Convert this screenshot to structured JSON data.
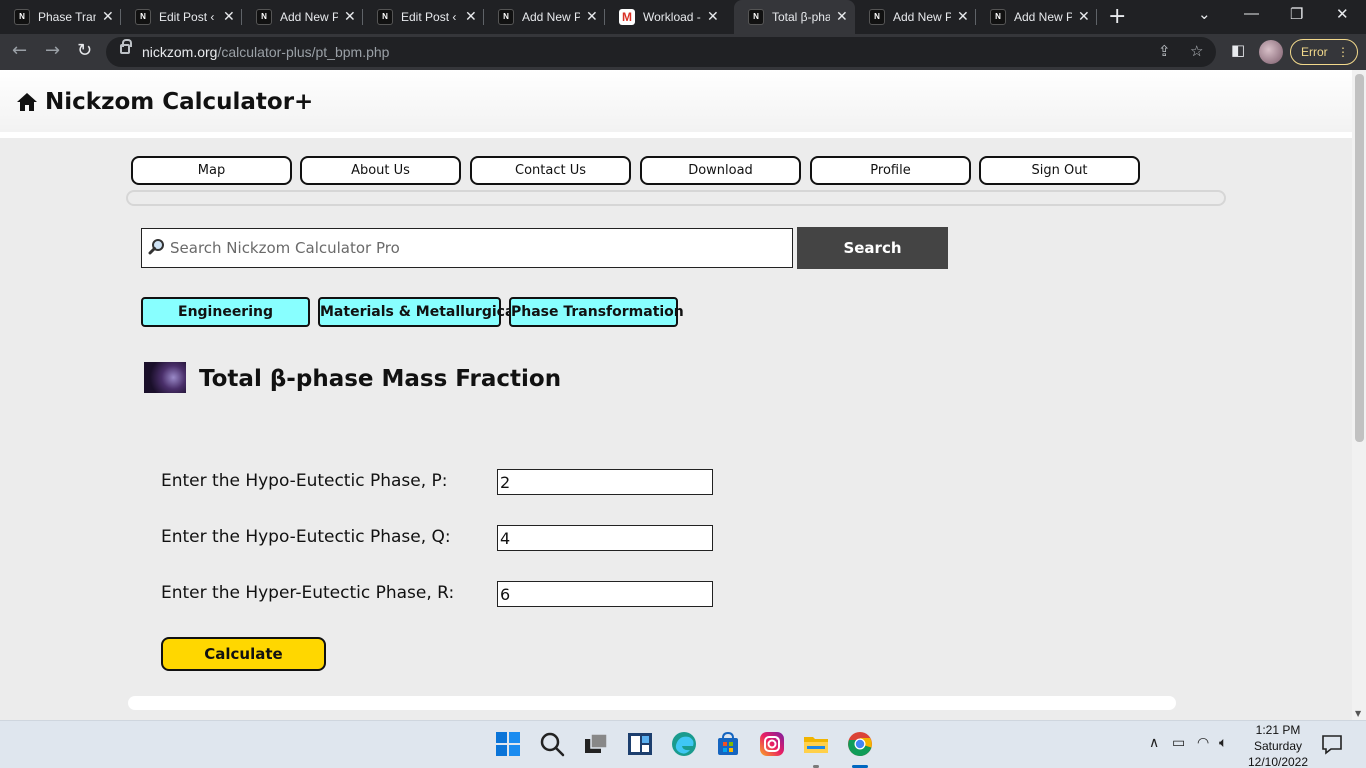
{
  "browser": {
    "tabs": [
      {
        "title": "Phase Tran",
        "icon": "nickzom-icon"
      },
      {
        "title": "Edit Post ‹",
        "icon": "nickzom-icon"
      },
      {
        "title": "Add New P",
        "icon": "nickzom-icon"
      },
      {
        "title": "Edit Post ‹",
        "icon": "nickzom-icon"
      },
      {
        "title": "Add New P",
        "icon": "nickzom-icon"
      },
      {
        "title": "Workload -",
        "icon": "gmail-icon"
      },
      {
        "title": "Total β-pha",
        "icon": "nickzom-icon",
        "active": true
      },
      {
        "title": "Add New P",
        "icon": "nickzom-icon"
      },
      {
        "title": "Add New P",
        "icon": "nickzom-icon"
      }
    ],
    "url_host": "nickzom.org",
    "url_path": "/calculator-plus/pt_bpm.php",
    "error_label": "Error"
  },
  "site": {
    "brand": "Nickzom Calculator+",
    "menu": [
      "Map",
      "About Us",
      "Contact Us",
      "Download",
      "Profile",
      "Sign Out"
    ],
    "search_placeholder": "Search Nickzom Calculator Pro",
    "search_button": "Search",
    "categories": [
      "Engineering",
      "Materials & Metallurgical",
      "Phase Transformation"
    ],
    "page_title": "Total β-phase Mass Fraction",
    "fields": [
      {
        "label": "Enter the Hypo-Eutectic Phase, P:",
        "value": "2"
      },
      {
        "label": "Enter the Hypo-Eutectic Phase, Q:",
        "value": "4"
      },
      {
        "label": "Enter the Hyper-Eutectic Phase, R:",
        "value": "6"
      }
    ],
    "calculate_button": "Calculate"
  },
  "taskbar": {
    "time": "1:21 PM",
    "day": "Saturday",
    "date": "12/10/2022"
  },
  "colors": {
    "category_bg": "#88ffff",
    "calculate_bg": "#ffd700",
    "search_button_bg": "#444444"
  }
}
